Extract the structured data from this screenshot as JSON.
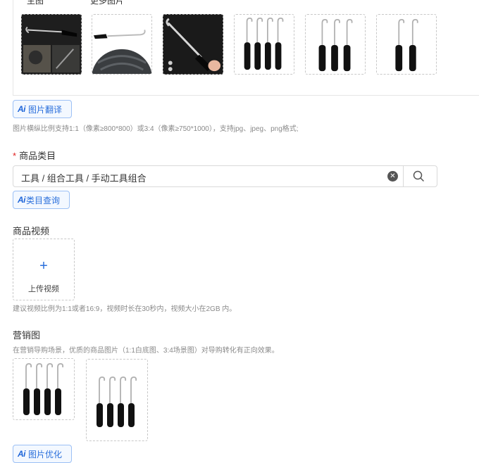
{
  "images": {
    "main_label": "主图",
    "more_label": "更多图片",
    "ai_translate_label": "图片翻译",
    "hint": "图片横纵比例支持1:1（像素≥800*800）或3:4（像素≥750*1000），支持jpg、jpeg、png格式;"
  },
  "category": {
    "required_mark": "*",
    "label": "商品类目",
    "value": "工具 / 组合工具 / 手动工具组合",
    "ai_query_label": "类目查询"
  },
  "video": {
    "label": "商品视频",
    "upload_icon": "+",
    "upload_label": "上传视频",
    "hint": "建议视频比例为1:1或者16:9，视频时长在30秒内，视频大小在2GB 内。"
  },
  "marketing": {
    "label": "营销图",
    "hint": "在营销导购场景，优质的商品图片（1:1白底图、3:4场景图）对导购转化有正向效果。",
    "ai_optimize_label": "图片优化"
  },
  "ai_badge": "Ai",
  "colors": {
    "accent": "#2a6fdb",
    "required": "#e02020",
    "border": "#d9d9d9"
  }
}
